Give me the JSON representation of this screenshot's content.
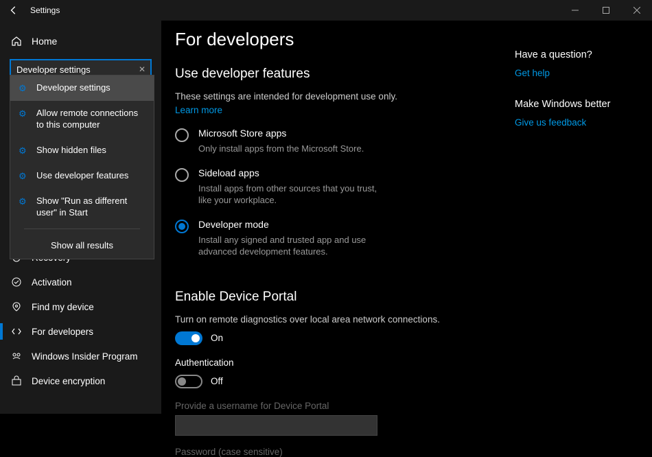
{
  "window": {
    "title": "Settings"
  },
  "sidebar": {
    "home_label": "Home",
    "search_value": "Developer settings",
    "nav_items": [
      {
        "icon": "recovery",
        "label": "Recovery"
      },
      {
        "icon": "activation",
        "label": "Activation"
      },
      {
        "icon": "find",
        "label": "Find my device"
      },
      {
        "icon": "dev",
        "label": "For developers",
        "selected": true
      },
      {
        "icon": "insider",
        "label": "Windows Insider Program"
      },
      {
        "icon": "encryption",
        "label": "Device encryption"
      }
    ]
  },
  "suggestions": {
    "items": [
      {
        "label": "Developer settings",
        "highlight": true
      },
      {
        "label": "Allow remote connections to this computer"
      },
      {
        "label": "Show hidden files"
      },
      {
        "label": "Use developer features"
      },
      {
        "label": "Show \"Run as different user\" in Start"
      }
    ],
    "show_all": "Show all results"
  },
  "page": {
    "title": "For developers",
    "section1": {
      "heading": "Use developer features",
      "desc": "These settings are intended for development use only.",
      "learn_more": "Learn more",
      "options": [
        {
          "label": "Microsoft Store apps",
          "desc": "Only install apps from the Microsoft Store.",
          "checked": false
        },
        {
          "label": "Sideload apps",
          "desc": "Install apps from other sources that you trust, like your workplace.",
          "checked": false
        },
        {
          "label": "Developer mode",
          "desc": "Install any signed and trusted app and use advanced development features.",
          "checked": true
        }
      ]
    },
    "section2": {
      "heading": "Enable Device Portal",
      "desc": "Turn on remote diagnostics over local area network connections.",
      "toggle1_state": "On",
      "auth_label": "Authentication",
      "toggle2_state": "Off",
      "username_label": "Provide a username for Device Portal",
      "password_label": "Password (case sensitive)"
    }
  },
  "aside": {
    "q_heading": "Have a question?",
    "q_link": "Get help",
    "f_heading": "Make Windows better",
    "f_link": "Give us feedback"
  }
}
